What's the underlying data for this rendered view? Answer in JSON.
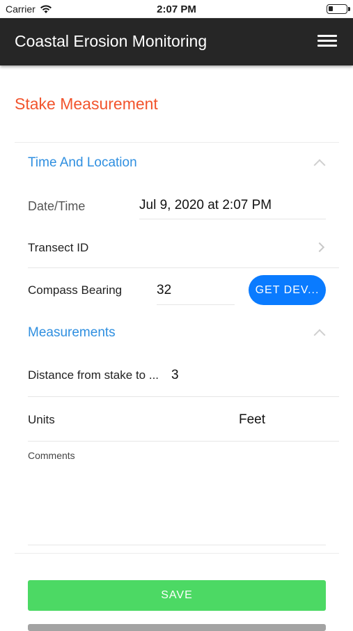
{
  "status_bar": {
    "carrier": "Carrier",
    "time": "2:07 PM"
  },
  "app_bar": {
    "title": "Coastal Erosion Monitoring",
    "menu_icon": "hamburger-menu-icon"
  },
  "page_title": "Stake Measurement",
  "sections": {
    "time_location": {
      "title": "Time And Location",
      "date_time": {
        "label": "Date/Time",
        "value": "Jul 9, 2020 at 2:07 PM"
      },
      "transect": {
        "label": "Transect ID",
        "value": ""
      },
      "compass": {
        "label": "Compass Bearing",
        "value": "32",
        "button_label": "GET DEV..."
      }
    },
    "measurements": {
      "title": "Measurements",
      "distance": {
        "label": "Distance from stake to ...",
        "value": "3"
      },
      "units": {
        "label": "Units",
        "value": "Feet"
      },
      "comments": {
        "label": "Comments",
        "value": ""
      }
    }
  },
  "actions": {
    "save_label": "SAVE"
  },
  "colors": {
    "accent": "#f2542d",
    "section": "#2f8fe0",
    "primary_button": "#0a7bff",
    "save": "#4cd964",
    "app_bar": "#262626"
  }
}
